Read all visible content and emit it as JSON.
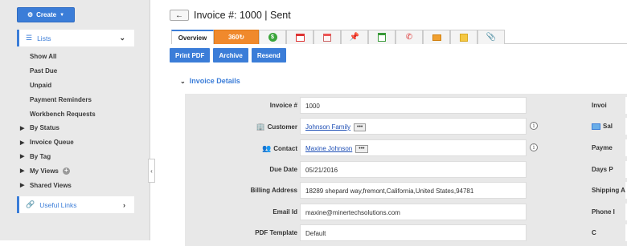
{
  "sidebar": {
    "create_label": "Create",
    "lists_label": "Lists",
    "menu": [
      {
        "label": "Show All"
      },
      {
        "label": "Past Due"
      },
      {
        "label": "Unpaid"
      },
      {
        "label": "Payment Reminders"
      },
      {
        "label": "Workbench Requests"
      },
      {
        "label": "By Status"
      },
      {
        "label": "Invoice Queue"
      },
      {
        "label": "By Tag"
      },
      {
        "label": "My Views"
      },
      {
        "label": "Shared Views"
      }
    ],
    "useful_links_label": "Useful Links"
  },
  "header": {
    "title": "Invoice #: 1000 | Sent"
  },
  "tabs": {
    "overview": "Overview",
    "t360": "360"
  },
  "actions": {
    "print": "Print PDF",
    "archive": "Archive",
    "resend": "Resend"
  },
  "section": {
    "title": "Invoice Details"
  },
  "fields": {
    "invoice_no": {
      "label": "Invoice #",
      "value": "1000"
    },
    "customer": {
      "label": "Customer",
      "value": "Johnson Family"
    },
    "contact": {
      "label": "Contact",
      "value": "Maxine Johnson"
    },
    "due_date": {
      "label": "Due Date",
      "value": "05/21/2016"
    },
    "billing": {
      "label": "Billing Address",
      "value": "18289 shepard way,fremont,California,United States,94781"
    },
    "email": {
      "label": "Email Id",
      "value": "maxine@minertechsolutions.com"
    },
    "pdf": {
      "label": "PDF Template",
      "value": "Default"
    }
  },
  "right_labels": {
    "r1": "Invoi",
    "r2": "Sal",
    "r3": "Payme",
    "r4": "Days P",
    "r5": "Shipping A",
    "r6": "Phone I",
    "r7": "C"
  },
  "glyphs": {
    "dots": "•••",
    "info": "i"
  },
  "colors": {
    "accent": "#3b7dd8",
    "tab_360": "#f0892c",
    "sidebar_bg": "#e9e9e9",
    "details_bg": "#e8e8e8"
  }
}
